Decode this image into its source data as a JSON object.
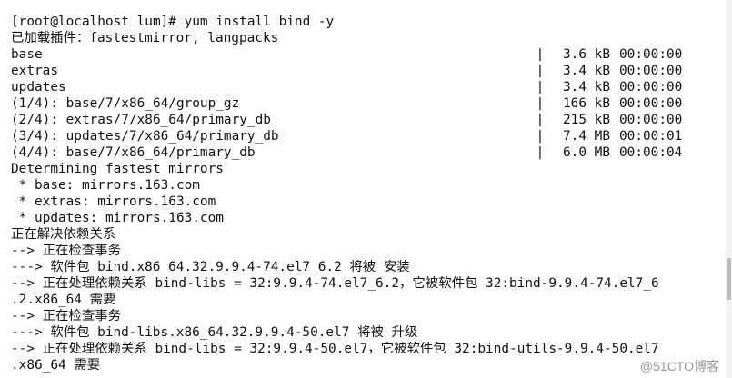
{
  "terminal": {
    "prompt": "[root@localhost lum]# yum install bind -y",
    "plugins": "已加载插件：fastestmirror, langpacks",
    "downloads": [
      {
        "name": "base",
        "size": "3.6 kB",
        "time": "00:00:00"
      },
      {
        "name": "extras",
        "size": "3.4 kB",
        "time": "00:00:00"
      },
      {
        "name": "updates",
        "size": "3.4 kB",
        "time": "00:00:00"
      },
      {
        "name": "(1/4): base/7/x86_64/group_gz",
        "size": "166 kB",
        "time": "00:00:00"
      },
      {
        "name": "(2/4): extras/7/x86_64/primary_db",
        "size": "215 kB",
        "time": "00:00:00"
      },
      {
        "name": "(3/4): updates/7/x86_64/primary_db",
        "size": "7.4 MB",
        "time": "00:00:01"
      },
      {
        "name": "(4/4): base/7/x86_64/primary_db",
        "size": "6.0 MB",
        "time": "00:00:04"
      }
    ],
    "output_lines": [
      "Determining fastest mirrors",
      " * base: mirrors.163.com",
      " * extras: mirrors.163.com",
      " * updates: mirrors.163.com",
      "正在解决依赖关系",
      "--> 正在检查事务",
      "---> 软件包 bind.x86_64.32.9.9.4-74.el7_6.2 将被 安装",
      "--> 正在处理依赖关系 bind-libs = 32:9.9.4-74.el7_6.2，它被软件包 32:bind-9.9.4-74.el7_6",
      ".2.x86_64 需要",
      "--> 正在检查事务",
      "---> 软件包 bind-libs.x86_64.32.9.9.4-50.el7 将被 升级",
      "--> 正在处理依赖关系 bind-libs = 32:9.9.4-50.el7，它被软件包 32:bind-utils-9.9.4-50.el7",
      ".x86_64 需要"
    ]
  },
  "watermark": {
    "text": "@51CTO博客"
  }
}
